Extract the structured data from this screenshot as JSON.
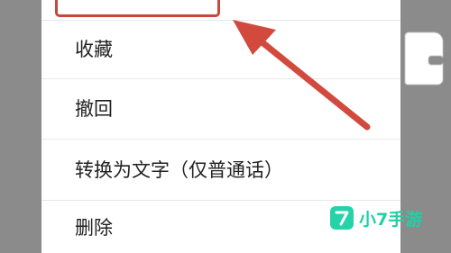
{
  "context_menu": {
    "items": [
      {
        "label": "收藏"
      },
      {
        "label": "撤回"
      },
      {
        "label": "转换为文字（仅普通话）"
      },
      {
        "label": "删除"
      }
    ]
  },
  "annotation": {
    "color": "#d24a3e"
  },
  "watermark": {
    "text": "小7手游",
    "color": "#24d3a8",
    "logo_glyph": "7"
  }
}
